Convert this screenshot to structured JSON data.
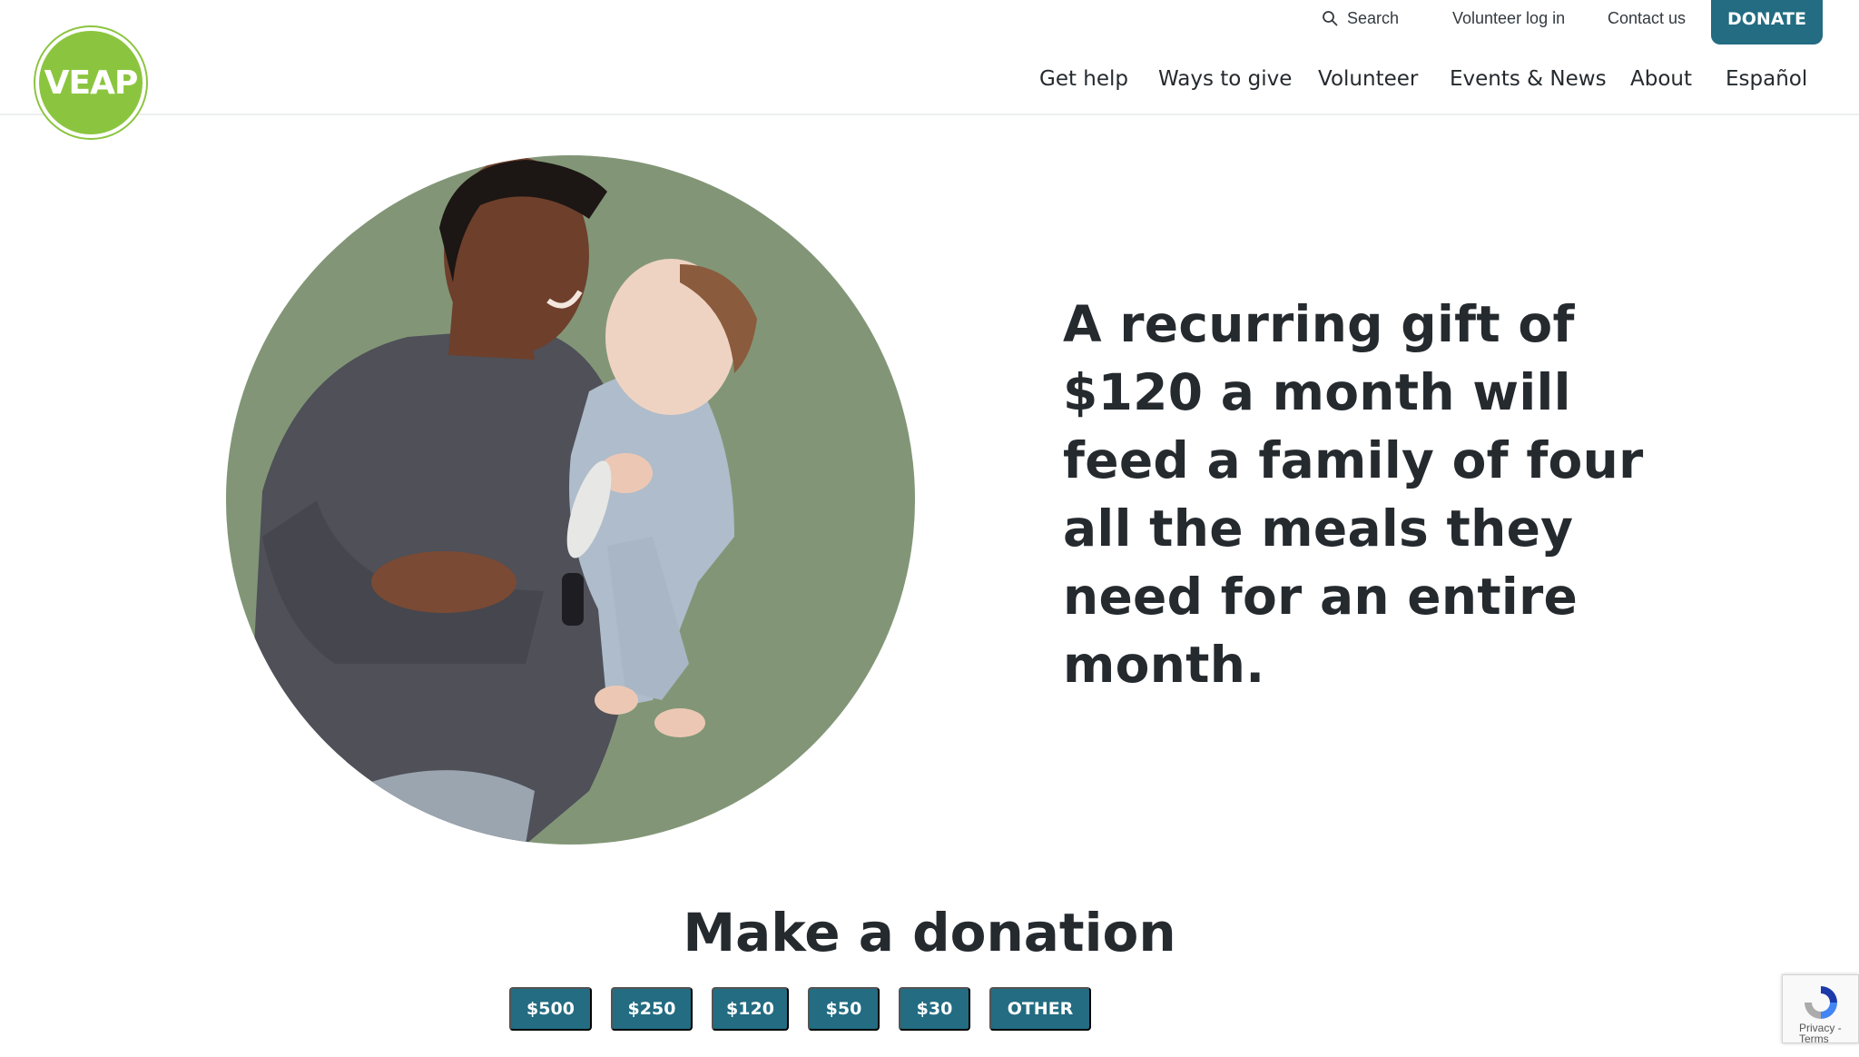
{
  "logo": {
    "text": "VEAP"
  },
  "utility_nav": {
    "search_label": "Search",
    "volunteer_login": "Volunteer log in",
    "contact": "Contact us",
    "donate": "DONATE"
  },
  "main_nav": {
    "items": [
      "Get help",
      "Ways to give",
      "Volunteer",
      "Events & News",
      "About",
      "Español"
    ]
  },
  "hero": {
    "headline_lines": [
      "A recurring gift of",
      "$120 a month will",
      "feed a family of four",
      "all the meals they",
      "need for an entire",
      "month."
    ]
  },
  "donation": {
    "title": "Make a donation",
    "amounts": [
      "$500",
      "$250",
      "$120",
      "$50",
      "$30",
      "OTHER"
    ]
  },
  "recaptcha": {
    "privacy": "Privacy",
    "terms": "Terms",
    "separator": " - "
  },
  "colors": {
    "brand_green": "#8bc53f",
    "primary_teal": "#236c82",
    "text_dark": "#252a2f"
  },
  "icons": {
    "search": "search-icon",
    "recaptcha": "recaptcha-icon"
  }
}
